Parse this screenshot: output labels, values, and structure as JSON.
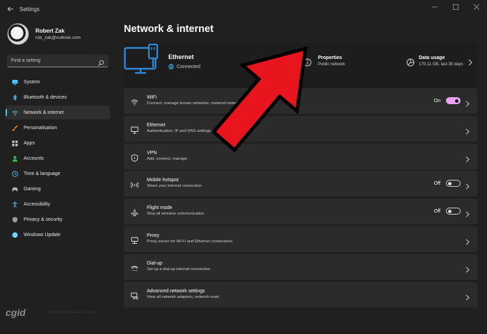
{
  "window": {
    "title": "Settings"
  },
  "profile": {
    "name": "Robert Zak",
    "email": "rob_zak@outlook.com"
  },
  "search": {
    "placeholder": "Find a setting"
  },
  "sidebar": {
    "items": [
      {
        "label": "System",
        "icon": "monitor-icon"
      },
      {
        "label": "Bluetooth & devices",
        "icon": "bluetooth-icon"
      },
      {
        "label": "Network & internet",
        "icon": "wifi-icon",
        "active": true
      },
      {
        "label": "Personalisation",
        "icon": "brush-icon"
      },
      {
        "label": "Apps",
        "icon": "apps-icon"
      },
      {
        "label": "Accounts",
        "icon": "person-icon"
      },
      {
        "label": "Time & language",
        "icon": "clock-globe-icon"
      },
      {
        "label": "Gaming",
        "icon": "gamepad-icon"
      },
      {
        "label": "Accessibility",
        "icon": "accessibility-icon"
      },
      {
        "label": "Privacy & security",
        "icon": "shield-icon"
      },
      {
        "label": "Windows Update",
        "icon": "update-icon"
      }
    ]
  },
  "main": {
    "title": "Network & internet",
    "ethernet": {
      "title": "Ethernet",
      "status": "Connected",
      "properties_title": "Properties",
      "properties_sub": "Public network",
      "usage_title": "Data usage",
      "usage_sub": "170.11 GB, last 30 days"
    },
    "rows": [
      {
        "title": "WiFi",
        "sub": "Connect, manage known networks, metered network",
        "toggle": "On",
        "icon": "wifi-icon"
      },
      {
        "title": "Ethernet",
        "sub": "Authentication, IP and DNS settings, metered network",
        "icon": "ethernet-icon"
      },
      {
        "title": "VPN",
        "sub": "Add, connect, manage",
        "icon": "vpn-shield-icon"
      },
      {
        "title": "Mobile hotspot",
        "sub": "Share your internet connection",
        "toggle": "Off",
        "icon": "hotspot-icon"
      },
      {
        "title": "Flight mode",
        "sub": "Stop all wireless communication",
        "toggle": "Off",
        "icon": "airplane-icon"
      },
      {
        "title": "Proxy",
        "sub": "Proxy server for Wi-Fi and Ethernet connections",
        "icon": "proxy-icon"
      },
      {
        "title": "Dial-up",
        "sub": "Set up a dial-up internet connection",
        "icon": "dialup-icon"
      },
      {
        "title": "Advanced network settings",
        "sub": "View all network adapters, network reset",
        "icon": "advanced-network-icon"
      }
    ]
  },
  "colors": {
    "accent": "#4cc2ff",
    "toggle_on": "#e9a0ff",
    "arrow": "#e8141e",
    "bg": "#202020",
    "card": "#2b2b2b"
  },
  "watermark": {
    "logo": "cgid",
    "text": "www.cgdirector.com"
  }
}
